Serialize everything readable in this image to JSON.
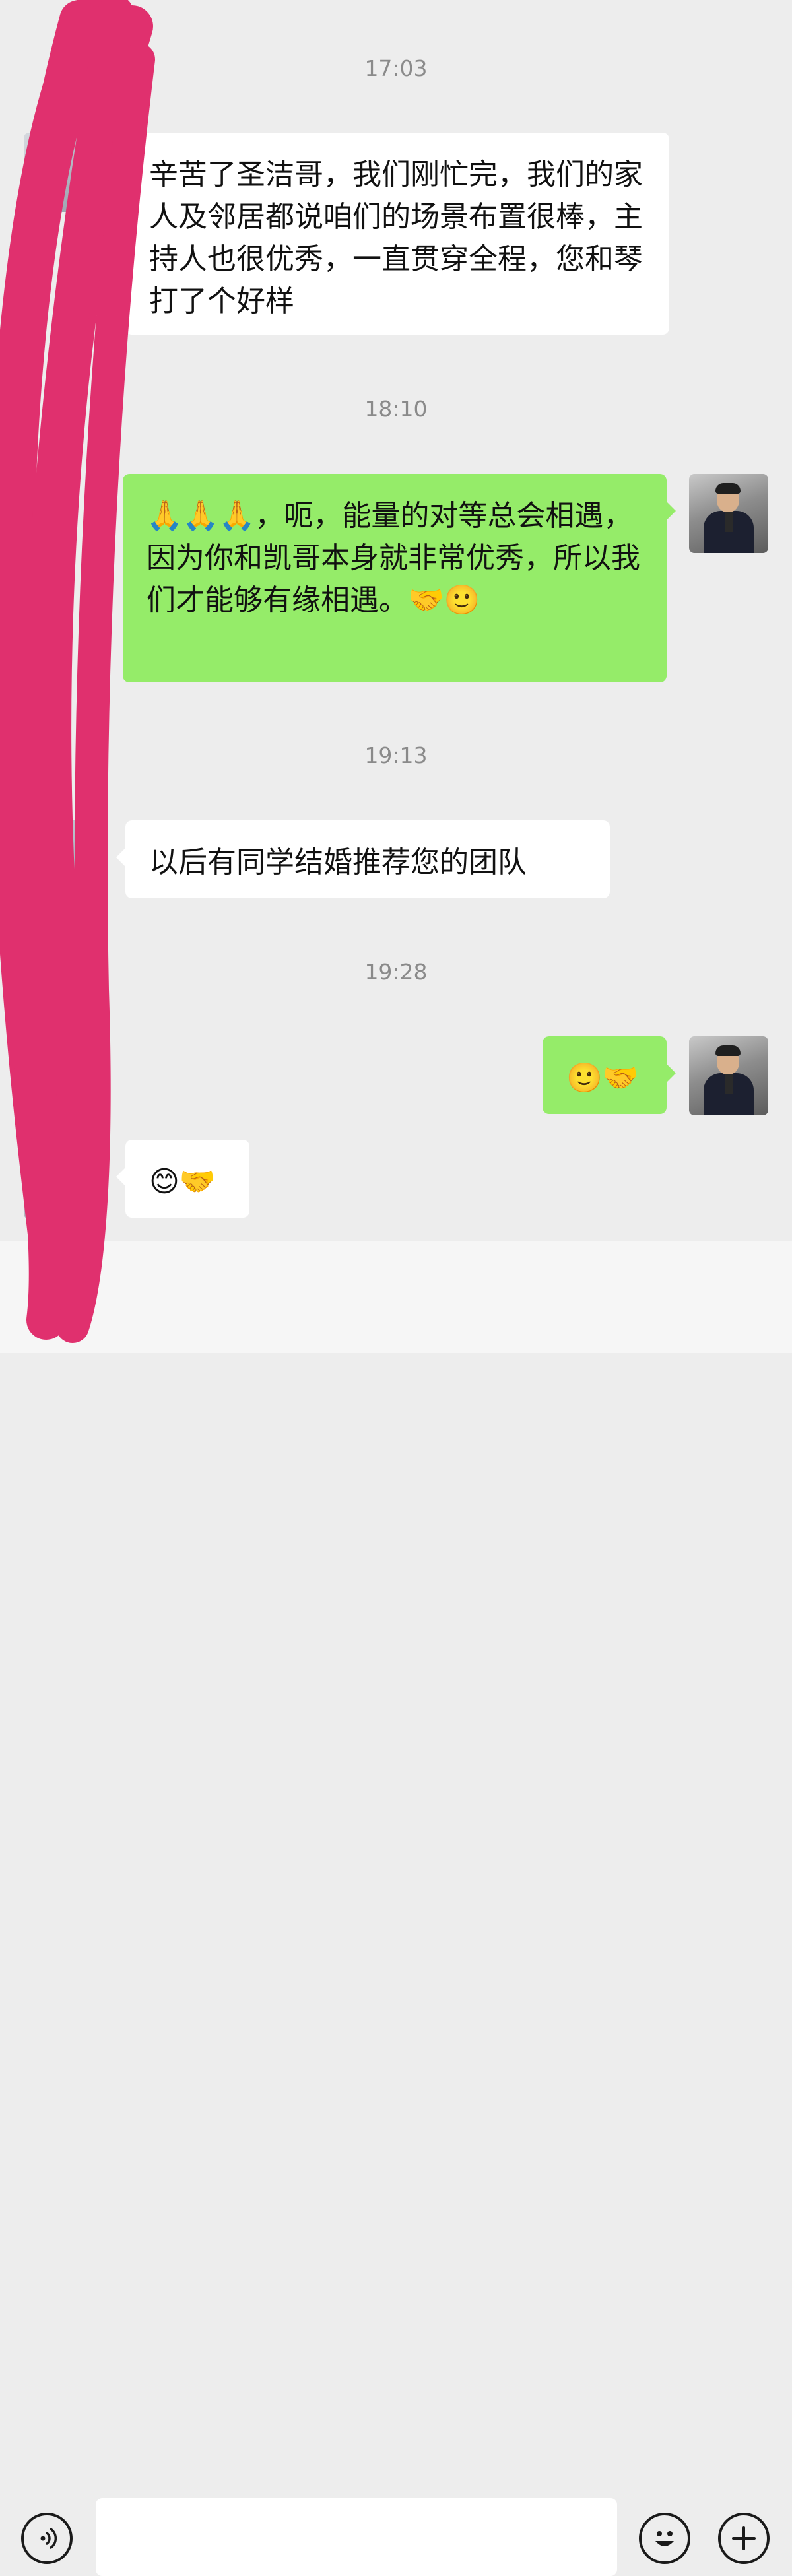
{
  "messages": [
    {
      "type": "time",
      "text": "17:03"
    },
    {
      "type": "in",
      "text": "辛苦了圣洁哥，我们刚忙完，我们的家人及邻居都说咱们的场景布置很棒，主持人也很优秀，一直贯穿全程，您和琴打了个好样"
    },
    {
      "type": "time",
      "text": "18:10"
    },
    {
      "type": "out",
      "text": "🙏🙏🙏，呃，能量的对等总会相遇，因为你和凯哥本身就非常优秀，所以我们才能够有缘相遇。🤝🙂"
    },
    {
      "type": "time",
      "text": "19:13"
    },
    {
      "type": "in",
      "text": "以后有同学结婚推荐您的团队"
    },
    {
      "type": "time",
      "text": "19:28"
    },
    {
      "type": "out",
      "text": "🙂🤝"
    },
    {
      "type": "in",
      "text": "😊🤝"
    }
  ],
  "input": {
    "value": "",
    "placeholder": ""
  },
  "icons": {
    "voice": "voice-icon",
    "emoji": "emoji-icon",
    "plus": "plus-icon"
  },
  "colors": {
    "background": "#ededed",
    "outgoing_bubble": "#95ec69",
    "incoming_bubble": "#ffffff",
    "timestamp": "#8a8a8a",
    "redaction_scribble": "#e0306e"
  }
}
